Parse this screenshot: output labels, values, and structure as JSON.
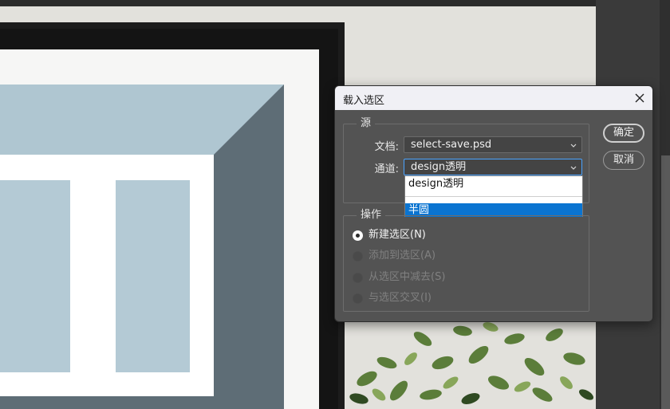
{
  "dialog": {
    "title": "载入选区",
    "source_group": {
      "label": "源",
      "document_label": "文档:",
      "document_value": "select-save.psd",
      "channel_label": "通道:",
      "channel_value": "design透明",
      "channel_options": [
        "design透明",
        "半圆"
      ],
      "highlighted_option": "半圆"
    },
    "operation_group": {
      "label": "操作",
      "options": [
        {
          "label": "新建选区(N)",
          "selected": true,
          "enabled": true
        },
        {
          "label": "添加到选区(A)",
          "selected": false,
          "enabled": false
        },
        {
          "label": "从选区中减去(S)",
          "selected": false,
          "enabled": false
        },
        {
          "label": "与选区交叉(I)",
          "selected": false,
          "enabled": false
        }
      ]
    },
    "buttons": {
      "ok": "确定",
      "cancel": "取消"
    }
  },
  "colors": {
    "dialog_bg": "#535353",
    "titlebar_bg": "#f0f0f5",
    "highlight": "#0a74d1",
    "focus_border": "#4aa3ff"
  },
  "icons": {
    "close": "close-icon",
    "dropdown": "chevron-down-icon"
  }
}
